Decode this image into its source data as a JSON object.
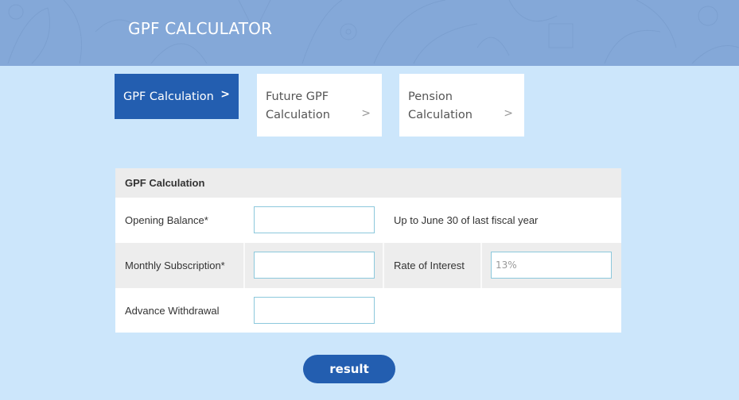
{
  "header": {
    "title": "GPF CALCULATOR"
  },
  "tabs": [
    {
      "label": "GPF Calculation",
      "active": true,
      "icon": "chevron-right-icon",
      "chevron": ">"
    },
    {
      "label": "Future GPF Calculation",
      "active": false,
      "icon": "chevron-right-icon",
      "chevron": ">"
    },
    {
      "label": "Pension Calculation",
      "active": false,
      "icon": "chevron-right-icon",
      "chevron": ">"
    }
  ],
  "form": {
    "title": "GPF Calculation",
    "opening_balance": {
      "label": "Opening Balance*",
      "value": "",
      "placeholder": "",
      "note": "Up to June 30 of last fiscal year"
    },
    "monthly_subscription": {
      "label": "Monthly Subscription*",
      "value": "",
      "placeholder": ""
    },
    "rate_of_interest": {
      "label": "Rate of Interest",
      "value": "",
      "placeholder": "13%"
    },
    "advance_withdrawal": {
      "label": "Advance Withdrawal",
      "value": "",
      "placeholder": ""
    }
  },
  "actions": {
    "result_label": "result"
  },
  "colors": {
    "header_bg": "#84a8d8",
    "page_bg": "#cce6fb",
    "accent": "#235eb0",
    "input_border": "#8cc8dc"
  }
}
